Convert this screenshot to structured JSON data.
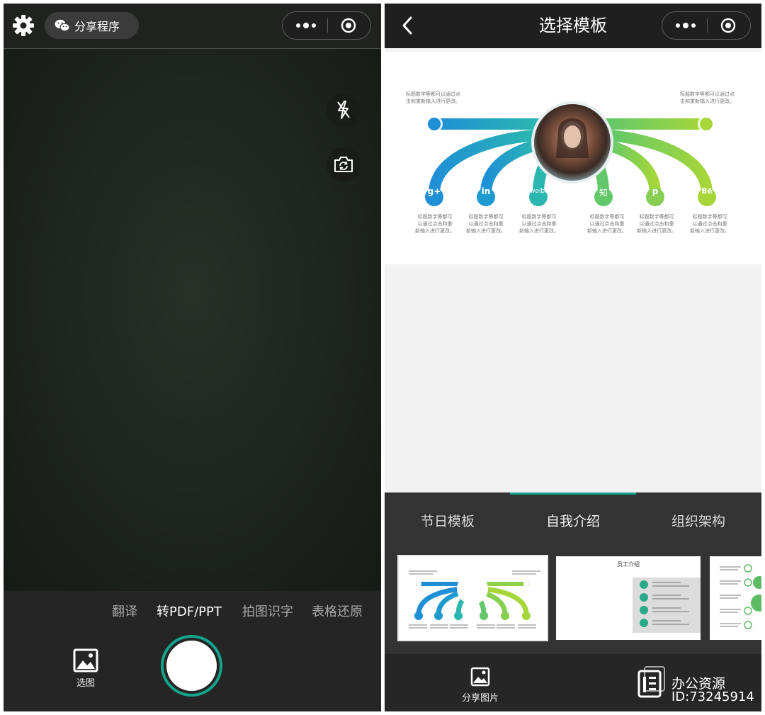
{
  "left_screen": {
    "share_button_label": "分享程序",
    "modes": [
      "翻译",
      "转PDF/PPT",
      "拍图识字",
      "表格还原"
    ],
    "active_mode": "转PDF/PPT",
    "album_label": "选图",
    "icons": {
      "settings": "gear-icon",
      "share": "wechat-icon",
      "more": "more-dots-icon",
      "close": "target-circle-icon",
      "flash": "flash-off-icon",
      "switch_camera": "camera-switch-icon",
      "album": "image-icon"
    }
  },
  "right_screen": {
    "title": "选择模板",
    "tabs": [
      "节日模板",
      "自我介绍",
      "组织架构"
    ],
    "active_tab": "自我介绍",
    "share_image_label": "分享图片",
    "accent_color": "#17a58d",
    "template_preview": {
      "caption_top_left": [
        "标题数字等都可以通过点",
        "击和重新输入进行更改。"
      ],
      "caption_top_right": [
        "标题数字等都可以通过点",
        "击和重新输入进行更改。"
      ],
      "item_captions": [
        [
          "标题数字等都可",
          "以通过点击和重",
          "新输入进行更改。"
        ],
        [
          "标题数字等都可",
          "以通过点击和重",
          "新输入进行更改。"
        ],
        [
          "标题数字等都可",
          "以通过点击和重",
          "新输入进行更改。"
        ],
        [
          "标题数字等都可",
          "以通过点击和重",
          "新输入进行更改。"
        ],
        [
          "标题数字等都可",
          "以通过点击和重",
          "新输入进行更改。"
        ],
        [
          "标题数字等都可",
          "以通过点击和重",
          "新输入进行更改。"
        ]
      ],
      "social_icons": [
        "g+",
        "in",
        "weibo",
        "知",
        "p",
        "Bē"
      ]
    },
    "thumbnails": [
      {
        "name": "social-arc-template"
      },
      {
        "name": "staff-intro-template",
        "heading": "员工介绍"
      },
      {
        "name": "list-template"
      }
    ]
  },
  "watermark": {
    "line1": "办公资源",
    "line2": "ID:73245914"
  }
}
